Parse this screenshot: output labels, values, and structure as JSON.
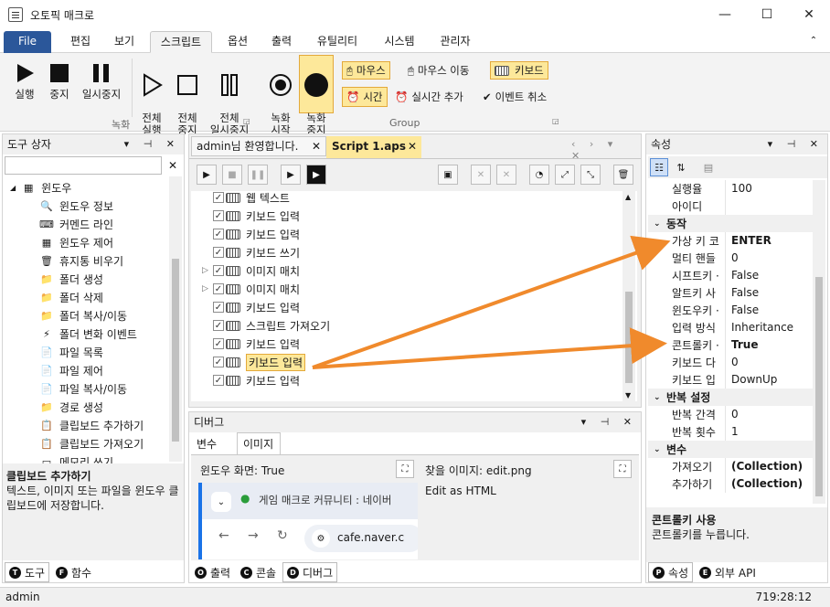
{
  "window": {
    "title": "오토픽 매크로",
    "minimize": "—",
    "maximize": "☐",
    "close": "✕"
  },
  "menu": [
    "File",
    "편집",
    "보기",
    "스크립트",
    "옵션",
    "출력",
    "유틸리티",
    "시스템",
    "관리자"
  ],
  "menu_collapse": "⌃",
  "ribbon": {
    "run": "실행",
    "stop": "중지",
    "pause": "일시중지",
    "run_all": "전체\n실행",
    "stop_all": "전체\n중지",
    "pause_all": "전체\n일시중지",
    "record_start": "녹화\n시작",
    "record_stop": "녹화\n중지",
    "group_record": "녹화",
    "group_group": "Group",
    "mouse": "마우스",
    "mouse_move": "마우스 이동",
    "keyboard": "키보드",
    "time": "시간",
    "realtime_add": "실시간 추가",
    "event_cancel": "이벤트 취소"
  },
  "toolbox": {
    "title": "도구 상자",
    "search_placeholder": "",
    "category": "윈도우",
    "items": [
      "윈도우 정보",
      "커멘드 라인",
      "윈도우 제어",
      "휴지통 비우기",
      "폴더 생성",
      "폴더 삭제",
      "폴더 복사/이동",
      "폴더 변화 이벤트",
      "파일 목록",
      "파일 제어",
      "파일 복사/이동",
      "경로 생성",
      "클립보드 추가하기",
      "클립보드 가져오기",
      "메모리 쓰기"
    ],
    "desc_title": "클립보드 추가하기",
    "desc_text": "텍스트, 이미지 또는 파일을 윈도우 클립보드에 저장합니다.",
    "tabs": [
      "도구",
      "함수"
    ]
  },
  "editor": {
    "tabs": [
      "admin님 환영합니다.",
      "Script 1.aps"
    ],
    "lines": [
      "웹 텍스트",
      "키보드 입력",
      "키보드 입력",
      "키보드 쓰기",
      "이미지 매치",
      "이미지 매치",
      "키보드 입력",
      "스크립트 가져오기",
      "키보드 입력",
      "키보드 입력",
      "키보드 입력"
    ]
  },
  "debug": {
    "title": "디버그",
    "tabs": [
      "변수",
      "이미지"
    ],
    "window_label": "윈도우 화면: True",
    "find_label": "찾을 이미지: edit.png",
    "find_content": "Edit as HTML",
    "browser_tab": "게임 매크로 커뮤니티 : 네이버",
    "browser_url": "cafe.naver.c",
    "bottom_tabs": [
      "출력",
      "콘솔",
      "디버그"
    ]
  },
  "properties": {
    "title": "속성",
    "rows": [
      {
        "type": "prop",
        "name": "실행율",
        "value": "100"
      },
      {
        "type": "prop",
        "name": "아이디",
        "value": ""
      },
      {
        "type": "cat",
        "name": "동작"
      },
      {
        "type": "prop",
        "name": "가상 키 코",
        "value": "ENTER",
        "bold": true
      },
      {
        "type": "prop",
        "name": "멀티 핸들",
        "value": "0"
      },
      {
        "type": "prop",
        "name": "시프트키 ·",
        "value": "False"
      },
      {
        "type": "prop",
        "name": "알트키 사",
        "value": "False"
      },
      {
        "type": "prop",
        "name": "윈도우키 ·",
        "value": "False"
      },
      {
        "type": "prop",
        "name": "입력 방식",
        "value": "Inheritance"
      },
      {
        "type": "prop",
        "name": "콘트롤키 ·",
        "value": "True",
        "bold": true
      },
      {
        "type": "prop",
        "name": "키보드 다",
        "value": "0"
      },
      {
        "type": "prop",
        "name": "키보드 입",
        "value": "DownUp"
      },
      {
        "type": "cat",
        "name": "반복 설정"
      },
      {
        "type": "prop",
        "name": "반복 간격",
        "value": "0"
      },
      {
        "type": "prop",
        "name": "반복 횟수",
        "value": "1"
      },
      {
        "type": "cat",
        "name": "변수"
      },
      {
        "type": "prop",
        "name": "가져오기",
        "value": "(Collection)",
        "bold": true
      },
      {
        "type": "prop",
        "name": "추가하기",
        "value": "(Collection)",
        "bold": true
      }
    ],
    "desc_title": "콘트롤키 사용",
    "desc_text": "콘트롤키를 누릅니다.",
    "tabs": [
      "속성",
      "외부 API"
    ]
  },
  "status": {
    "user": "admin",
    "time": "719:28:12"
  },
  "colors": {
    "accent": "#2b579a",
    "highlight": "#fde89a",
    "arrow": "#f08a2c"
  }
}
